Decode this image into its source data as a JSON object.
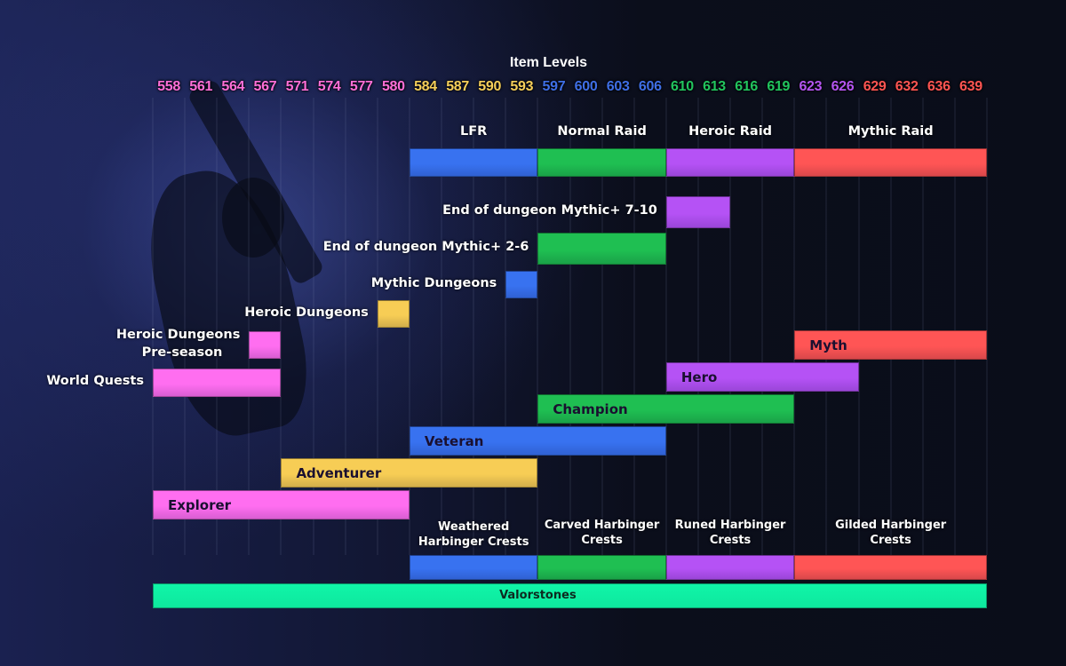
{
  "chart_data": {
    "type": "gantt-bar",
    "title": "Item Levels",
    "x_categories": [
      "558",
      "561",
      "564",
      "567",
      "571",
      "574",
      "577",
      "580",
      "584",
      "587",
      "590",
      "593",
      "597",
      "600",
      "603",
      "606",
      "610",
      "613",
      "616",
      "619",
      "623",
      "626",
      "629",
      "632",
      "636",
      "639"
    ],
    "tick_colors": [
      "#ff6fd8",
      "#ff6fd8",
      "#ff6fd8",
      "#ff6fd8",
      "#ff6fd8",
      "#ff6fd8",
      "#ff6fd8",
      "#ff6fd8",
      "#f6cf5a",
      "#f6cf5a",
      "#f6cf5a",
      "#f6cf5a",
      "#3f6fe6",
      "#3f6fe6",
      "#3f6fe6",
      "#3f6fe6",
      "#22c55e",
      "#22c55e",
      "#22c55e",
      "#22c55e",
      "#b455f0",
      "#b455f0",
      "#ff5552",
      "#ff5552",
      "#ff5552",
      "#ff5552"
    ],
    "colors": {
      "pink": "#ff6ef0",
      "yellow": "#f7cd55",
      "blue": "#3872f0",
      "green": "#1fbf52",
      "purple": "#b552f5",
      "red": "#ff5555",
      "teal": "#10f5a8"
    },
    "raid_row": [
      {
        "name": "LFR",
        "from": "584",
        "to": "593",
        "color": "blue"
      },
      {
        "name": "Normal Raid",
        "from": "597",
        "to": "606",
        "color": "green"
      },
      {
        "name": "Heroic Raid",
        "from": "610",
        "to": "619",
        "color": "purple"
      },
      {
        "name": "Mythic Raid",
        "from": "623",
        "to": "639",
        "color": "red"
      }
    ],
    "sources": [
      {
        "name": "End of dungeon Mythic+ 7-10",
        "from": "610",
        "to": "613",
        "color": "purple"
      },
      {
        "name": "End of dungeon Mythic+ 2-6",
        "from": "597",
        "to": "606",
        "color": "green"
      },
      {
        "name": "Mythic Dungeons",
        "from": "593",
        "to": "593",
        "color": "blue"
      },
      {
        "name": "Heroic Dungeons",
        "from": "580",
        "to": "580",
        "color": "yellow"
      },
      {
        "name": "Heroic Dungeons Pre-season",
        "name_line1": "Heroic Dungeons",
        "name_line2": "Pre-season",
        "from": "567",
        "to": "567",
        "color": "pink"
      },
      {
        "name": "World Quests",
        "from": "558",
        "to": "567",
        "color": "pink"
      }
    ],
    "tracks": [
      {
        "name": "Myth",
        "from": "623",
        "to": "639",
        "color": "red"
      },
      {
        "name": "Hero",
        "from": "610",
        "to": "626",
        "color": "purple"
      },
      {
        "name": "Champion",
        "from": "597",
        "to": "619",
        "color": "green"
      },
      {
        "name": "Veteran",
        "from": "584",
        "to": "606",
        "color": "blue"
      },
      {
        "name": "Adventurer",
        "from": "571",
        "to": "593",
        "color": "yellow"
      },
      {
        "name": "Explorer",
        "from": "558",
        "to": "580",
        "color": "pink"
      }
    ],
    "crests": [
      {
        "name": "Weathered Harbinger Crests",
        "line1": "Weathered",
        "line2": "Harbinger Crests",
        "from": "584",
        "to": "593",
        "color": "blue"
      },
      {
        "name": "Carved Harbinger Crests",
        "line1": "Carved Harbinger",
        "line2": "Crests",
        "from": "597",
        "to": "606",
        "color": "green"
      },
      {
        "name": "Runed Harbinger Crests",
        "line1": "Runed Harbinger",
        "line2": "Crests",
        "from": "610",
        "to": "619",
        "color": "purple"
      },
      {
        "name": "Gilded Harbinger Crests",
        "line1": "Gilded Harbinger",
        "line2": "Crests",
        "from": "623",
        "to": "639",
        "color": "red"
      }
    ],
    "valorstones": {
      "name": "Valorstones",
      "from": "558",
      "to": "639",
      "color": "teal"
    },
    "grid": true,
    "legend": "none"
  }
}
